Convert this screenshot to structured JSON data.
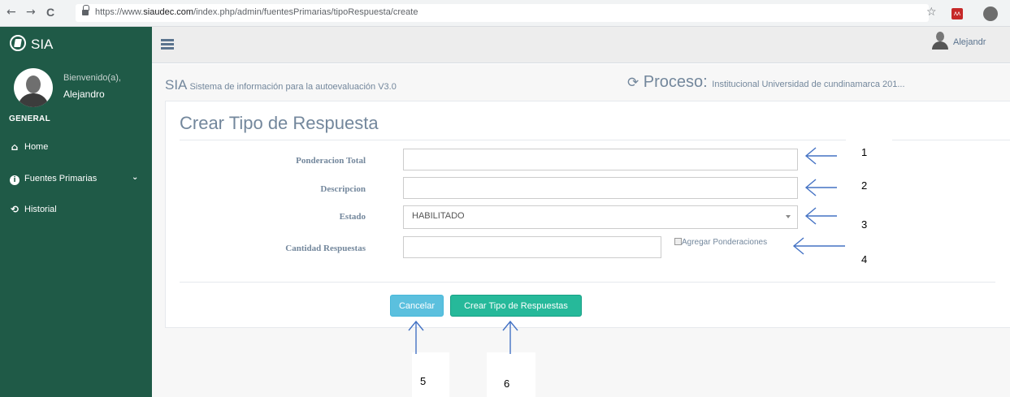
{
  "browser": {
    "back_glyph": "←",
    "forward_glyph": "→",
    "reload_glyph": "C",
    "url_prefix": "https://www.",
    "url_host": "siaudec.com",
    "url_path": "/index.php/admin/fuentesPrimarias/tipoRespuesta/create",
    "star_glyph": "☆",
    "ext_glyph": "ʌʌ"
  },
  "sidebar": {
    "brand": "SIA",
    "welcome": "Bienvenido(a),",
    "username": "Alejandro",
    "section": "GENERAL",
    "items": [
      {
        "label": "Home",
        "icon": "home-icon",
        "glyph": "🏠"
      },
      {
        "label": "Fuentes Primarias",
        "icon": "info-icon",
        "glyph": "i",
        "chevron": "⌄"
      },
      {
        "label": "Historial",
        "icon": "history-icon",
        "glyph": "⟲"
      }
    ]
  },
  "topbar": {
    "user_name": "Alejandr"
  },
  "subheader": {
    "sia": "SIA",
    "system_name": " Sistema de información para la autoevaluación V3.0",
    "refresh_glyph": "⟳",
    "proceso_label": " Proceso: ",
    "proceso_value": "Institucional Universidad de cundinamarca 201..."
  },
  "form": {
    "title": "Crear Tipo de Respuesta",
    "fields": {
      "ponderacion_label": "Ponderacion Total",
      "ponderacion_value": "",
      "descripcion_label": "Descripcion",
      "descripcion_value": "",
      "estado_label": "Estado",
      "estado_value": "HABILITADO",
      "cantidad_label": "Cantidad Respuestas",
      "cantidad_value": ""
    },
    "checkbox_label": "Agregar Ponderaciones",
    "cancel_button": "Cancelar",
    "create_button": "Crear Tipo de Respuestas"
  },
  "annotations": {
    "numbers": [
      "1",
      "2",
      "3",
      "4",
      "5",
      "6"
    ],
    "arrow_color": "#4472c4"
  },
  "colors": {
    "sidebar": "#1f5a47",
    "cancel": "#5bc0de",
    "create": "#26b99a",
    "muted_text": "#73879c"
  }
}
